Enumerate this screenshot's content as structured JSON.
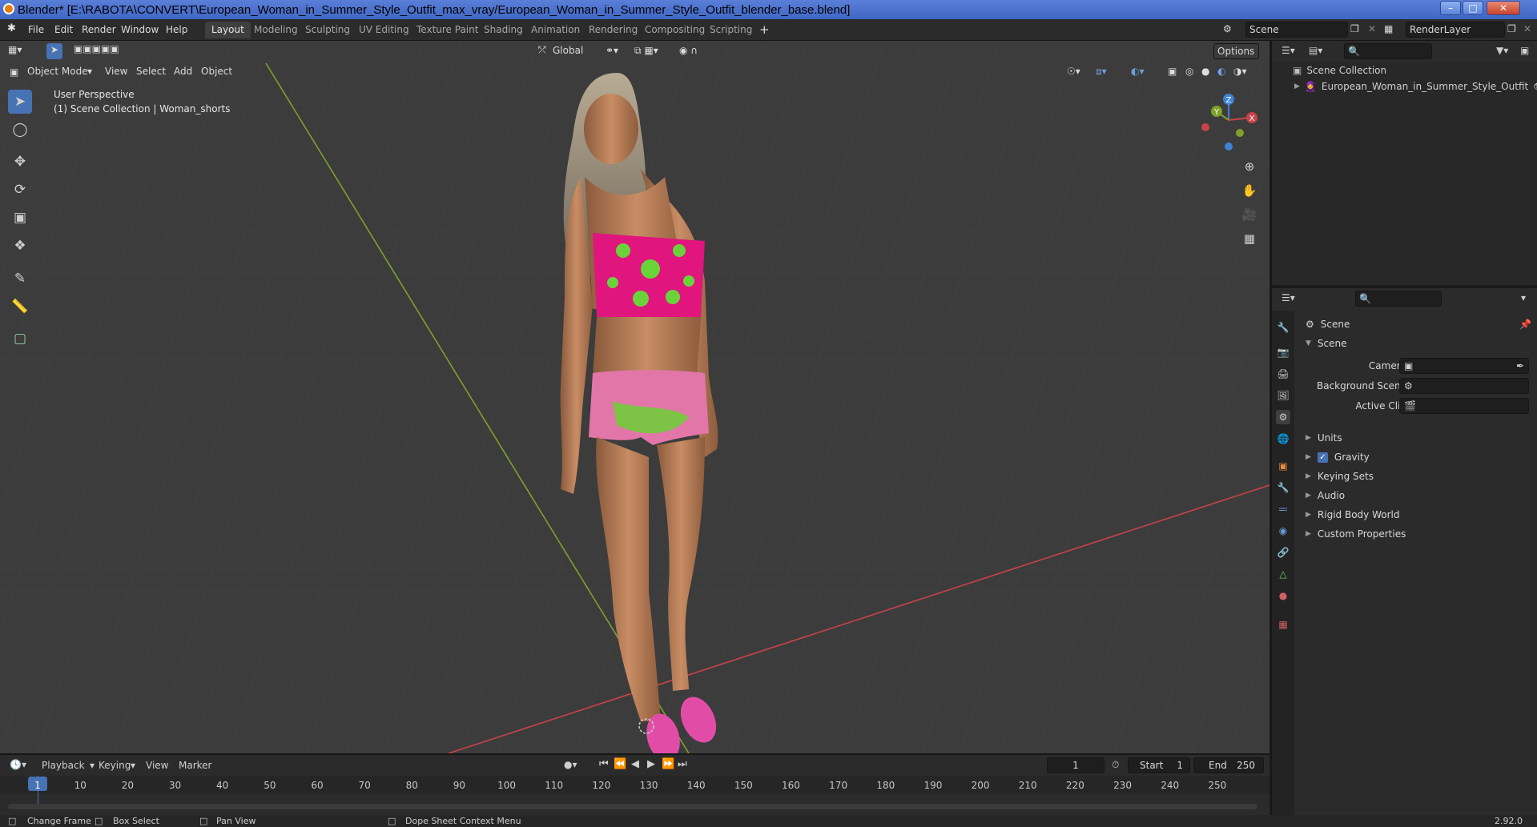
{
  "window": {
    "title": "Blender* [E:\\RABOTA\\CONVERT\\European_Woman_in_Summer_Style_Outfit_max_vray/European_Woman_in_Summer_Style_Outfit_blender_base.blend]",
    "minimize": "–",
    "maximize": "□",
    "close": "✕"
  },
  "topbar": {
    "menus": [
      "File",
      "Edit",
      "Render",
      "Window",
      "Help"
    ],
    "workspaces": [
      "Layout",
      "Modeling",
      "Sculpting",
      "UV Editing",
      "Texture Paint",
      "Shading",
      "Animation",
      "Rendering",
      "Compositing",
      "Scripting"
    ],
    "active_workspace": "Layout",
    "add_workspace": "+",
    "scene_name": "Scene",
    "view_layer": "RenderLayer"
  },
  "viewport": {
    "mode": "Object Mode",
    "menus": [
      "View",
      "Select",
      "Add",
      "Object"
    ],
    "transform_orientation": "Global",
    "options_label": "Options",
    "overlay_title": "User Perspective",
    "overlay_subtitle": "(1) Scene Collection | Woman_shorts",
    "gizmo_axes": {
      "x": "X",
      "y": "Y",
      "z": "Z"
    },
    "tools": [
      "select-box-icon",
      "cursor-icon",
      "move-icon",
      "rotate-icon",
      "scale-icon",
      "transform-icon",
      "annotate-icon",
      "measure-icon",
      "add-cube-icon"
    ],
    "colors": {
      "x_axis": "#c8434a",
      "y_axis": "#7fa12a",
      "z_axis": "#3d84d6",
      "background": "#3c3c3c",
      "active": "#4772b3"
    }
  },
  "outliner": {
    "root": "Scene Collection",
    "items": [
      {
        "label": "European_Woman_in_Summer_Style_Outfit"
      }
    ]
  },
  "properties": {
    "context": "Scene",
    "panel": "Scene",
    "fields": [
      {
        "label": "Camera",
        "value": ""
      },
      {
        "label": "Background Scene",
        "value": ""
      },
      {
        "label": "Active Clip",
        "value": ""
      }
    ],
    "sections": [
      "Units",
      "Gravity",
      "Keying Sets",
      "Audio",
      "Rigid Body World",
      "Custom Properties"
    ],
    "gravity_checked": true
  },
  "timeline": {
    "menus": [
      "Playback",
      "Keying",
      "View",
      "Marker"
    ],
    "current_frame": "1",
    "start_label": "Start",
    "start": "1",
    "end_label": "End",
    "end": "250",
    "ticks": [
      "1",
      "10",
      "20",
      "30",
      "40",
      "50",
      "60",
      "70",
      "80",
      "90",
      "100",
      "110",
      "120",
      "130",
      "140",
      "150",
      "160",
      "170",
      "180",
      "190",
      "200",
      "210",
      "220",
      "230",
      "240",
      "250"
    ]
  },
  "statusbar": {
    "items": [
      "Change Frame",
      "Box Select",
      "Pan View",
      "Dope Sheet Context Menu"
    ],
    "version": "2.92.0"
  }
}
